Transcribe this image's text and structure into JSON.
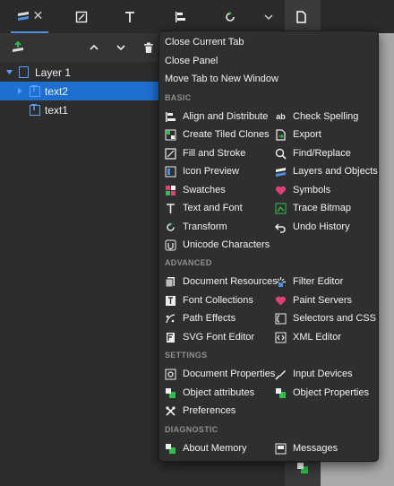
{
  "tree": {
    "layer": "Layer 1",
    "items": [
      "text2",
      "text1"
    ]
  },
  "menu": {
    "top": [
      "Close Current Tab",
      "Close Panel",
      "Move Tab to New Window"
    ],
    "sections": {
      "basic": "BASIC",
      "advanced": "ADVANCED",
      "settings": "SETTINGS",
      "diagnostic": "DIAGNOSTIC"
    },
    "basic_left": [
      "Align and Distribute",
      "Create Tiled Clones",
      "Fill and Stroke",
      "Icon Preview",
      "Swatches",
      "Text and Font",
      "Transform",
      "Unicode Characters"
    ],
    "basic_right": [
      "Check Spelling",
      "Export",
      "Find/Replace",
      "Layers and Objects",
      "Symbols",
      "Trace Bitmap",
      "Undo History"
    ],
    "advanced_left": [
      "Document Resources",
      "Font Collections",
      "Path Effects",
      "SVG Font Editor"
    ],
    "advanced_right": [
      "Filter Editor",
      "Paint Servers",
      "Selectors and CSS",
      "XML Editor"
    ],
    "settings_left": [
      "Document Properties",
      "Object attributes",
      "Preferences"
    ],
    "settings_right": [
      "Input Devices",
      "Object Properties"
    ],
    "diagnostic_left": [
      "About Memory"
    ],
    "diagnostic_right": [
      "Messages"
    ]
  },
  "colors": {
    "selection": "#1e6fcf",
    "accent": "#4a90e2",
    "green": "#2fbf4a",
    "pink": "#e0407a"
  }
}
